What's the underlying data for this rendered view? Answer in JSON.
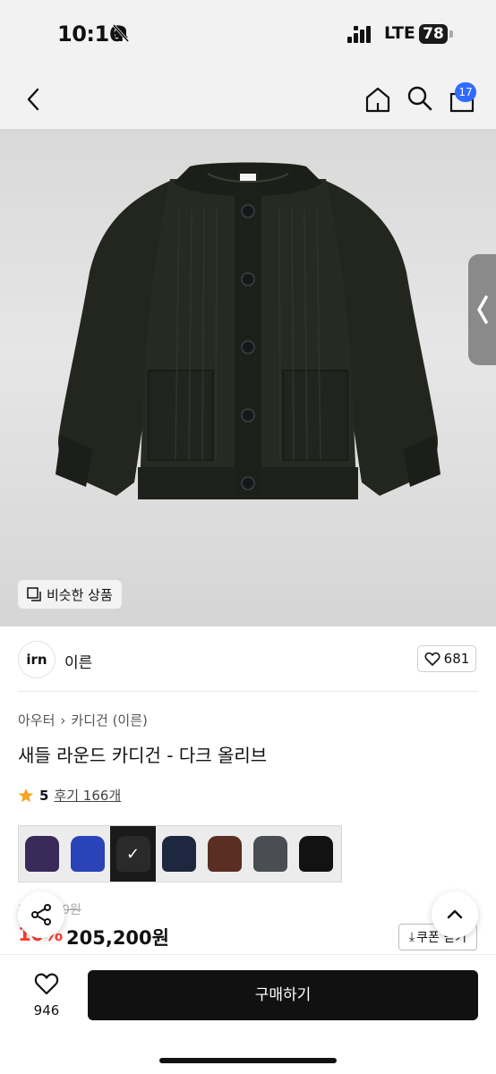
{
  "status_bar": {
    "time": "10:16",
    "network": "LTE",
    "battery": "78"
  },
  "nav": {
    "cart_count": "17"
  },
  "hero": {
    "similar_label": "비슷한 상품"
  },
  "brand": {
    "logo_text": "irn",
    "name": "이른",
    "likes": "681"
  },
  "product": {
    "breadcrumb": [
      "아우터",
      "카디건 (이른)"
    ],
    "title": "새들 라운드 카디건 - 다크 올리브",
    "rating": "5",
    "reviews": "후기 166개",
    "old_price": "228,000원",
    "discount": "10%",
    "price": "205,200원",
    "coupon_label": "쿠폰 받기"
  },
  "swatches": [
    {
      "color": "#3a2a5a",
      "selected": false
    },
    {
      "color": "#2a43b8",
      "selected": false
    },
    {
      "color": "#1a1a1a",
      "selected": true
    },
    {
      "color": "#1d2740",
      "selected": false
    },
    {
      "color": "#5a2e22",
      "selected": false
    },
    {
      "color": "#4a4d52",
      "selected": false
    },
    {
      "color": "#121212",
      "selected": false
    }
  ],
  "bottom": {
    "wish_count": "946",
    "buy_label": "구매하기"
  }
}
